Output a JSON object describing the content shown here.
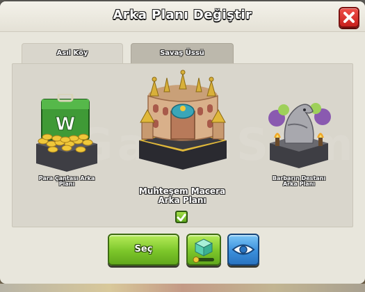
{
  "dialog": {
    "title": "Arka Planı Değiştir"
  },
  "tabs": [
    {
      "label": "Asıl Köy",
      "active": true
    },
    {
      "label": "Savaş Üssü",
      "active": false
    }
  ],
  "sceneries": [
    {
      "label_line1": "Para Çantası Arka",
      "label_line2": "Planı",
      "icon": "wwe-briefcase-gold-coins"
    },
    {
      "label_line1": "Muhteşem Macera",
      "label_line2": "Arka Planı",
      "icon": "colosseum-arena",
      "selected": true
    },
    {
      "label_line1": "Barbarın Destanı",
      "label_line2": "Arka Planı",
      "icon": "dragon-statue"
    }
  ],
  "buttons": {
    "select_label": "Seç",
    "gem_icon": "gem-cube-icon",
    "preview_icon": "eye-icon"
  },
  "colors": {
    "primary_green": "#7cc62a",
    "close_red": "#d8302a",
    "preview_blue": "#3a8fdc",
    "panel_bg": "#d9d6cc"
  }
}
